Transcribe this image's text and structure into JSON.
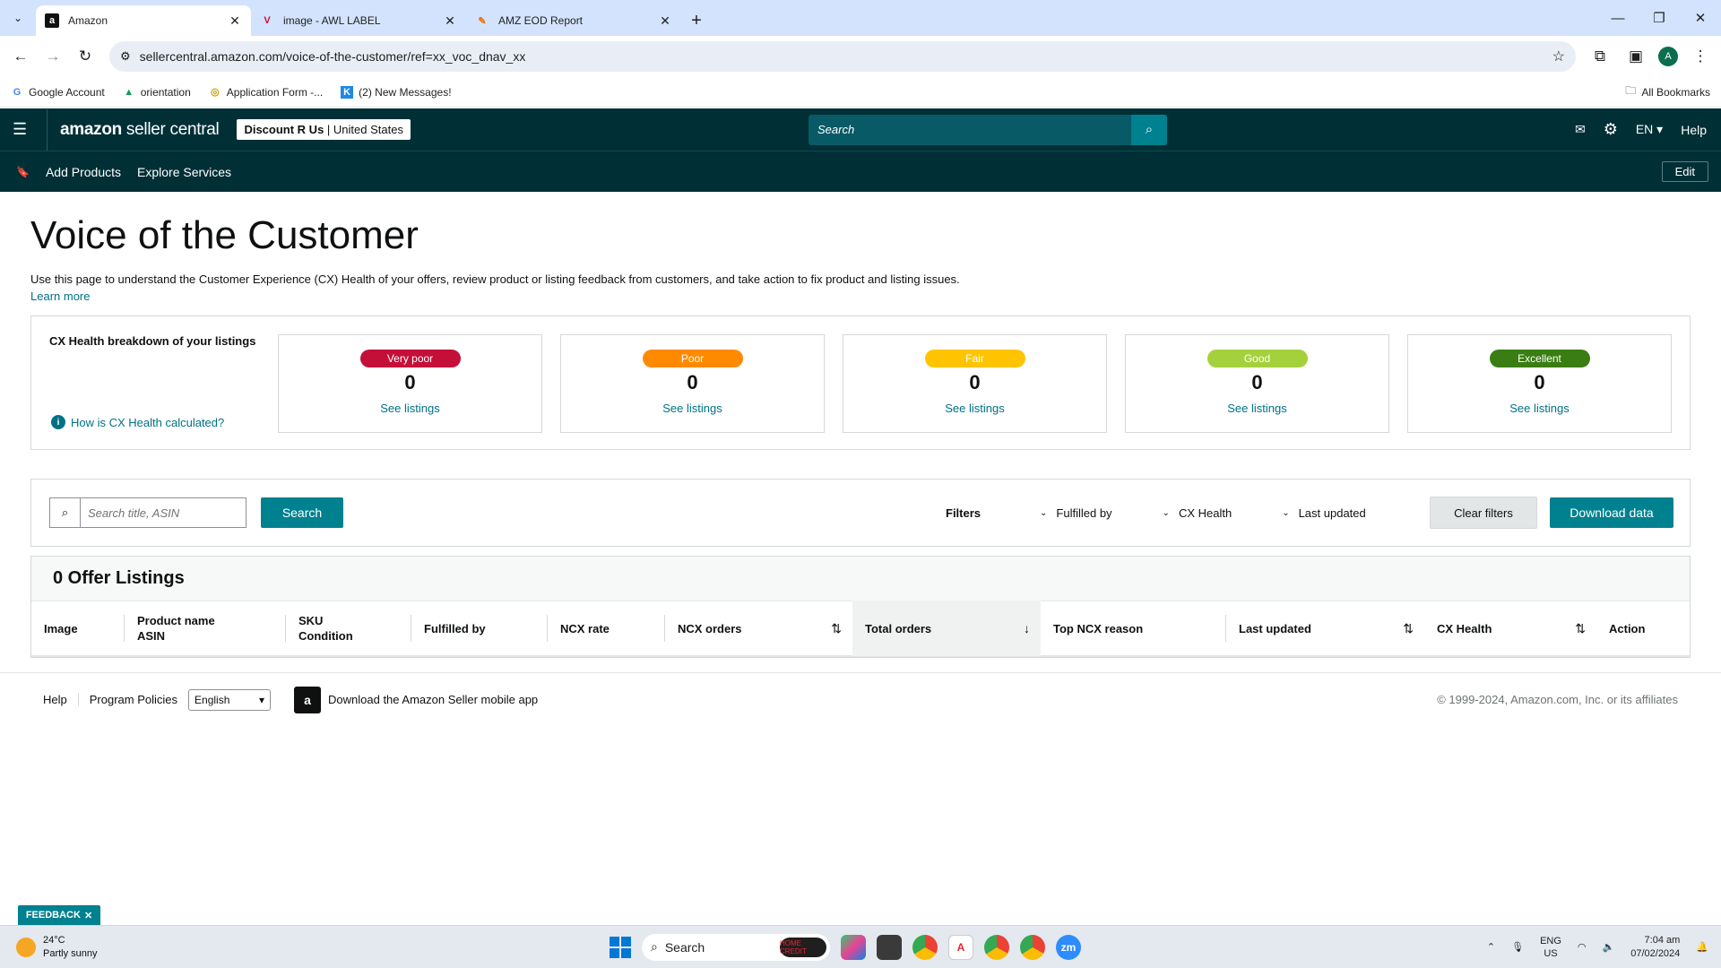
{
  "browser": {
    "tabs": [
      {
        "title": "Amazon",
        "active": true,
        "favicon": "a"
      },
      {
        "title": "image - AWL LABEL",
        "active": false,
        "favicon": "V"
      },
      {
        "title": "AMZ EOD Report",
        "active": false,
        "favicon": "✎"
      }
    ],
    "url": "sellercentral.amazon.com/voice-of-the-customer/ref=xx_voc_dnav_xx",
    "bookmarks": [
      {
        "label": "Google Account",
        "icon": "G"
      },
      {
        "label": "orientation",
        "icon": "▲"
      },
      {
        "label": "Application Form -...",
        "icon": "◎"
      },
      {
        "label": "(2) New Messages!",
        "icon": "K"
      }
    ],
    "all_bookmarks": "All Bookmarks",
    "avatar_letter": "A"
  },
  "header": {
    "logo_bold": "amazon",
    "logo_rest": " seller central",
    "store_name": "Discount R Us",
    "store_region": "United States",
    "search_placeholder": "Search",
    "lang": "EN",
    "help": "Help",
    "nav_links": [
      "Add Products",
      "Explore Services"
    ],
    "edit": "Edit"
  },
  "page": {
    "title": "Voice of the Customer",
    "description": "Use this page to understand the Customer Experience (CX) Health of your offers, review product or listing feedback from customers, and take action to fix product and listing issues.",
    "learn_more": "Learn more"
  },
  "cx_health": {
    "heading": "CX Health breakdown of your listings",
    "how_link": "How is CX Health calculated?",
    "cards": [
      {
        "label": "Very poor",
        "count": "0",
        "link": "See listings",
        "color": "#c40f39",
        "text_color": "#ffffff"
      },
      {
        "label": "Poor",
        "count": "0",
        "link": "See listings",
        "color": "#ff8a00",
        "text_color": "#ffffff"
      },
      {
        "label": "Fair",
        "count": "0",
        "link": "See listings",
        "color": "#ffc400",
        "text_color": "#ffffff"
      },
      {
        "label": "Good",
        "count": "0",
        "link": "See listings",
        "color": "#a4d13b",
        "text_color": "#ffffff"
      },
      {
        "label": "Excellent",
        "count": "0",
        "link": "See listings",
        "color": "#3a7d12",
        "text_color": "#ffffff"
      }
    ]
  },
  "filters": {
    "search_placeholder": "Search title, ASIN",
    "search_button": "Search",
    "label": "Filters",
    "dropdowns": [
      "Fulfilled by",
      "CX Health",
      "Last updated"
    ],
    "clear": "Clear filters",
    "download": "Download data"
  },
  "listings": {
    "heading": "0 Offer Listings",
    "columns": [
      {
        "line1": "Image",
        "line2": ""
      },
      {
        "line1": "Product name",
        "line2": "ASIN"
      },
      {
        "line1": "SKU",
        "line2": "Condition"
      },
      {
        "line1": "Fulfilled by",
        "line2": ""
      },
      {
        "line1": "NCX rate",
        "line2": ""
      },
      {
        "line1": "NCX orders",
        "line2": ""
      },
      {
        "line1": "Total orders",
        "line2": ""
      },
      {
        "line1": "Top NCX reason",
        "line2": ""
      },
      {
        "line1": "Last updated",
        "line2": ""
      },
      {
        "line1": "CX Health",
        "line2": ""
      },
      {
        "line1": "Action",
        "line2": ""
      }
    ]
  },
  "footer": {
    "help": "Help",
    "policies": "Program Policies",
    "language": "English",
    "app": "Download the Amazon Seller mobile app",
    "copyright": "© 1999-2024, Amazon.com, Inc. or its affiliates"
  },
  "feedback": "FEEDBACK",
  "taskbar": {
    "temp": "24°C",
    "weather": "Partly sunny",
    "search": "Search",
    "promo": "HOME CREDIT",
    "lang_top": "ENG",
    "lang_bottom": "US",
    "time": "7:04 am",
    "date": "07/02/2024"
  }
}
